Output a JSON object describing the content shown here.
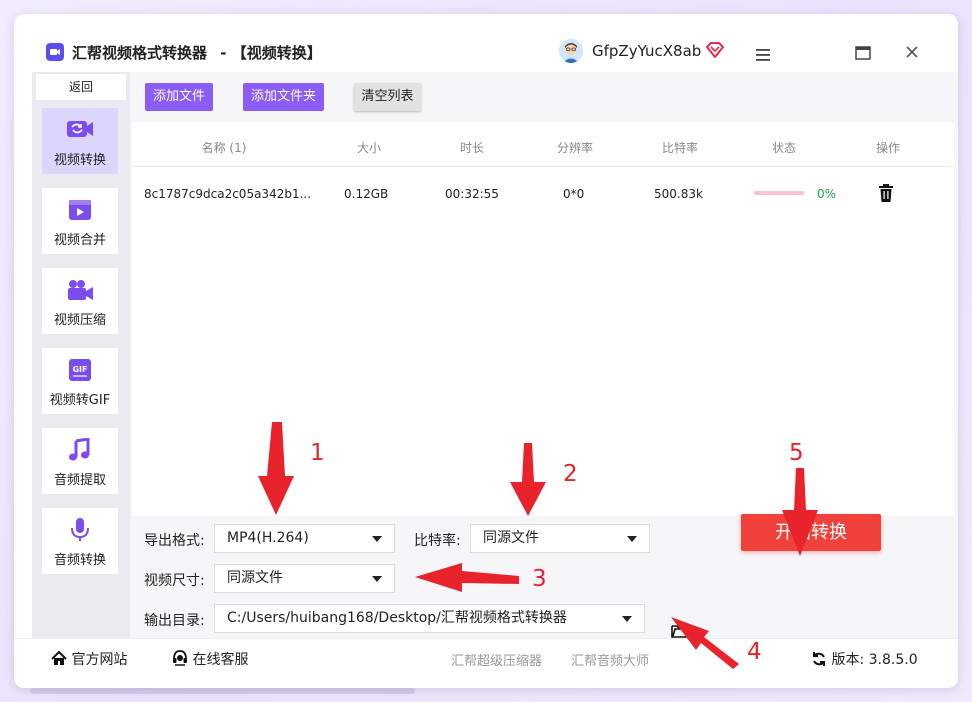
{
  "window": {
    "app_name": "汇帮视频格式转换器",
    "page_name": "【视频转换】",
    "separator": "-",
    "username": "GfpZyYucX8ab"
  },
  "icons": [
    "app-logo-icon",
    "avatar-icon",
    "vip-diamond-icon",
    "menu-icon",
    "maximize-icon",
    "close-icon",
    "video-convert-icon",
    "video-merge-icon",
    "video-compress-icon",
    "gif-icon",
    "music-note-icon",
    "microphone-icon",
    "trash-icon",
    "folder-open-icon",
    "home-icon",
    "headset-icon",
    "refresh-icon"
  ],
  "sidebar": {
    "back_label": "返回",
    "items": [
      {
        "label": "视频转换",
        "active": true
      },
      {
        "label": "视频合并"
      },
      {
        "label": "视频压缩"
      },
      {
        "label": "视频转GIF"
      },
      {
        "label": "音频提取"
      },
      {
        "label": "音频转换"
      }
    ]
  },
  "toolbar": {
    "add_file": "添加文件",
    "add_folder": "添加文件夹",
    "clear_list": "清空列表"
  },
  "table": {
    "headers": [
      "名称 (1)",
      "大小",
      "时长",
      "分辨率",
      "比特率",
      "状态",
      "操作"
    ],
    "rows": [
      {
        "name": "8c1787c9dca2c05a342b1...",
        "size": "0.12GB",
        "duration": "00:32:55",
        "resolution": "0*0",
        "bitrate": "500.83k",
        "progress": 0,
        "progress_text": "0%"
      }
    ]
  },
  "settings": {
    "format_label": "导出格式:",
    "format_value": "MP4(H.264)",
    "bitrate_label": "比特率:",
    "bitrate_value": "同源文件",
    "size_label": "视频尺寸:",
    "size_value": "同源文件",
    "output_label": "输出目录:",
    "output_value": "C:/Users/huibang168/Desktop/汇帮视频格式转换器",
    "start_button": "开始转换"
  },
  "footer": {
    "official_site": "官方网站",
    "online_service": "在线客服",
    "link1": "汇帮超级压缩器",
    "link2": "汇帮音频大师",
    "version_label": "版本:",
    "version": "3.8.5.0"
  },
  "annotations": [
    "1",
    "2",
    "3",
    "4",
    "5"
  ],
  "colors": {
    "accent": "#8b5cf6",
    "start": "#f0423a",
    "annotation": "#e8232b"
  }
}
